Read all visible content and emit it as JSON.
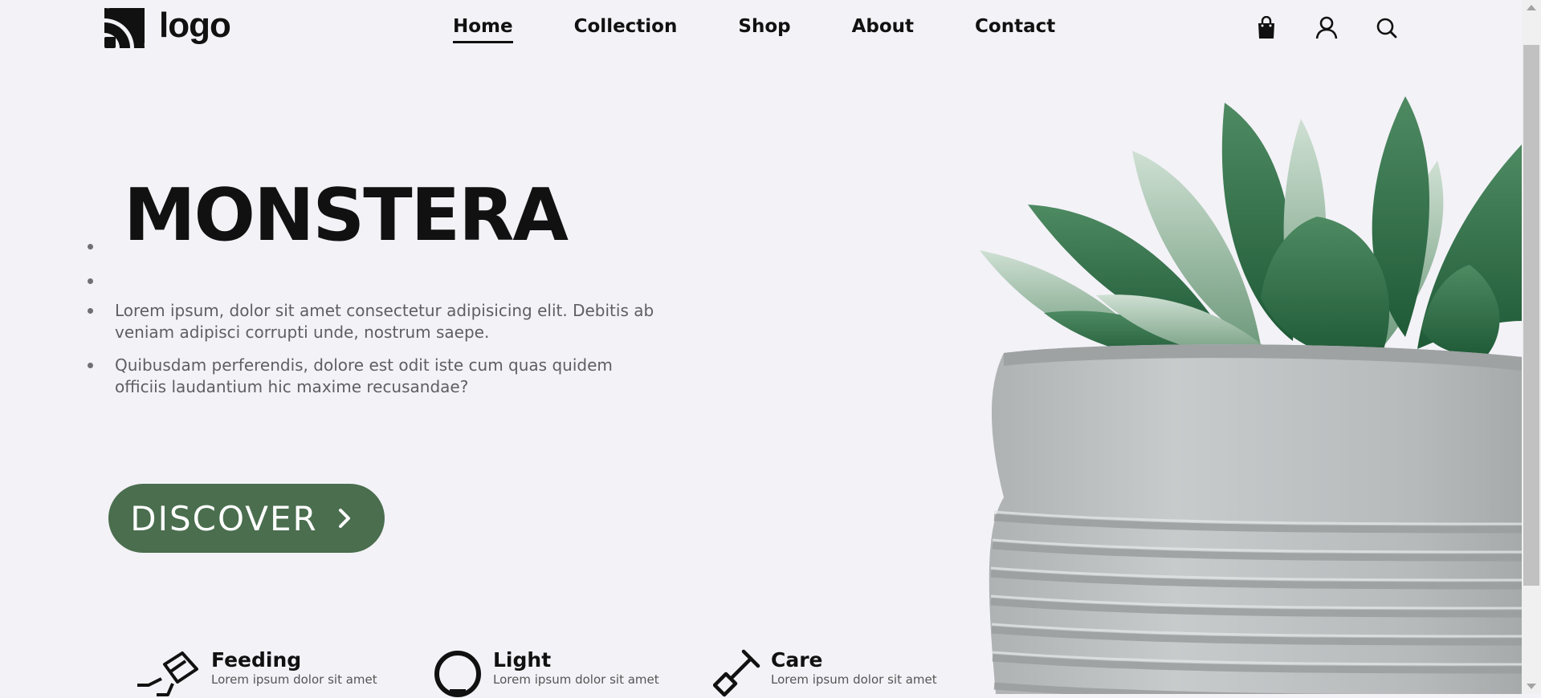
{
  "header": {
    "logo_text": "logo",
    "nav": [
      {
        "label": "Home",
        "active": true
      },
      {
        "label": "Collection",
        "active": false
      },
      {
        "label": "Shop",
        "active": false
      },
      {
        "label": "About",
        "active": false
      },
      {
        "label": "Contact",
        "active": false
      }
    ],
    "icons": [
      "shopping-bag-icon",
      "user-icon",
      "search-icon"
    ]
  },
  "hero": {
    "title": "MONSTERA",
    "paragraphs": [
      "Lorem ipsum, dolor sit amet consectetur adipisicing elit. Debitis ab veniam adipisci corrupti unde, nostrum saepe.",
      "Quibusdam perferendis, dolore est odit iste cum quas quidem officiis laudantium hic maxime recusandae?"
    ],
    "cta_label": "DISCOVER"
  },
  "features": [
    {
      "title": "Feeding",
      "text": "Lorem ipsum dolor sit amet",
      "icon": "watering-can-icon"
    },
    {
      "title": "Light",
      "text": "Lorem ipsum dolor sit amet",
      "icon": "lightbulb-icon"
    },
    {
      "title": "Care",
      "text": "Lorem ipsum dolor sit amet",
      "icon": "shovel-icon"
    }
  ],
  "colors": {
    "background": "#f3f2f7",
    "accent_green": "#4a6e4e",
    "text_dark": "#111111",
    "text_gray": "#5f5f63"
  }
}
